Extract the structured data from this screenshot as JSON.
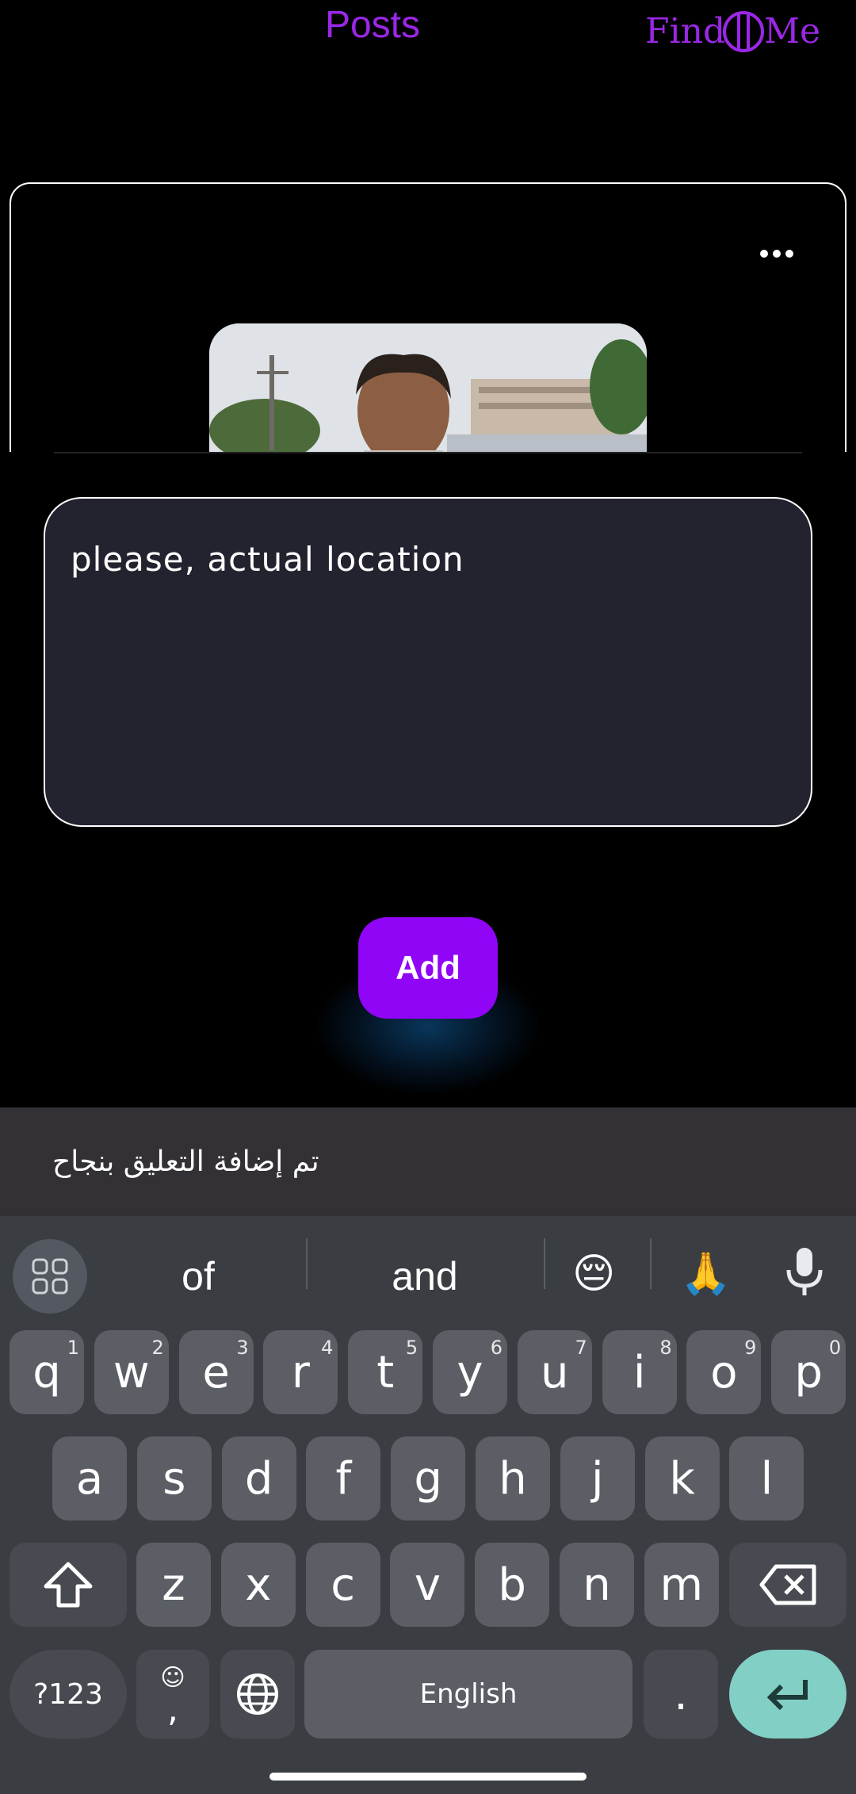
{
  "header": {
    "title": "Posts",
    "logo_text_left": "Find",
    "logo_text_right": "Me"
  },
  "post": {
    "more_icon": "more-horizontal-icon",
    "photo_desc_color": "#d9dde2"
  },
  "comment": {
    "value": "please, actual location"
  },
  "actions": {
    "add_label": "Add"
  },
  "toast": {
    "message": "تم إضافة التعليق بنجاح"
  },
  "keyboard": {
    "suggestions": [
      "of",
      "and"
    ],
    "emojis": [
      "😔",
      "🙏"
    ],
    "row1": [
      {
        "k": "q",
        "n": "1"
      },
      {
        "k": "w",
        "n": "2"
      },
      {
        "k": "e",
        "n": "3"
      },
      {
        "k": "r",
        "n": "4"
      },
      {
        "k": "t",
        "n": "5"
      },
      {
        "k": "y",
        "n": "6"
      },
      {
        "k": "u",
        "n": "7"
      },
      {
        "k": "i",
        "n": "8"
      },
      {
        "k": "o",
        "n": "9"
      },
      {
        "k": "p",
        "n": "0"
      }
    ],
    "row2": [
      "a",
      "s",
      "d",
      "f",
      "g",
      "h",
      "j",
      "k",
      "l"
    ],
    "row3": [
      "z",
      "x",
      "c",
      "v",
      "b",
      "n",
      "m"
    ],
    "symbols_label": "?123",
    "comma_label": ",",
    "space_label": "English",
    "period_label": ".",
    "accent_color": "#82cfc6"
  },
  "colors": {
    "brand": "#9b27e6",
    "add_button": "#9105f7"
  }
}
